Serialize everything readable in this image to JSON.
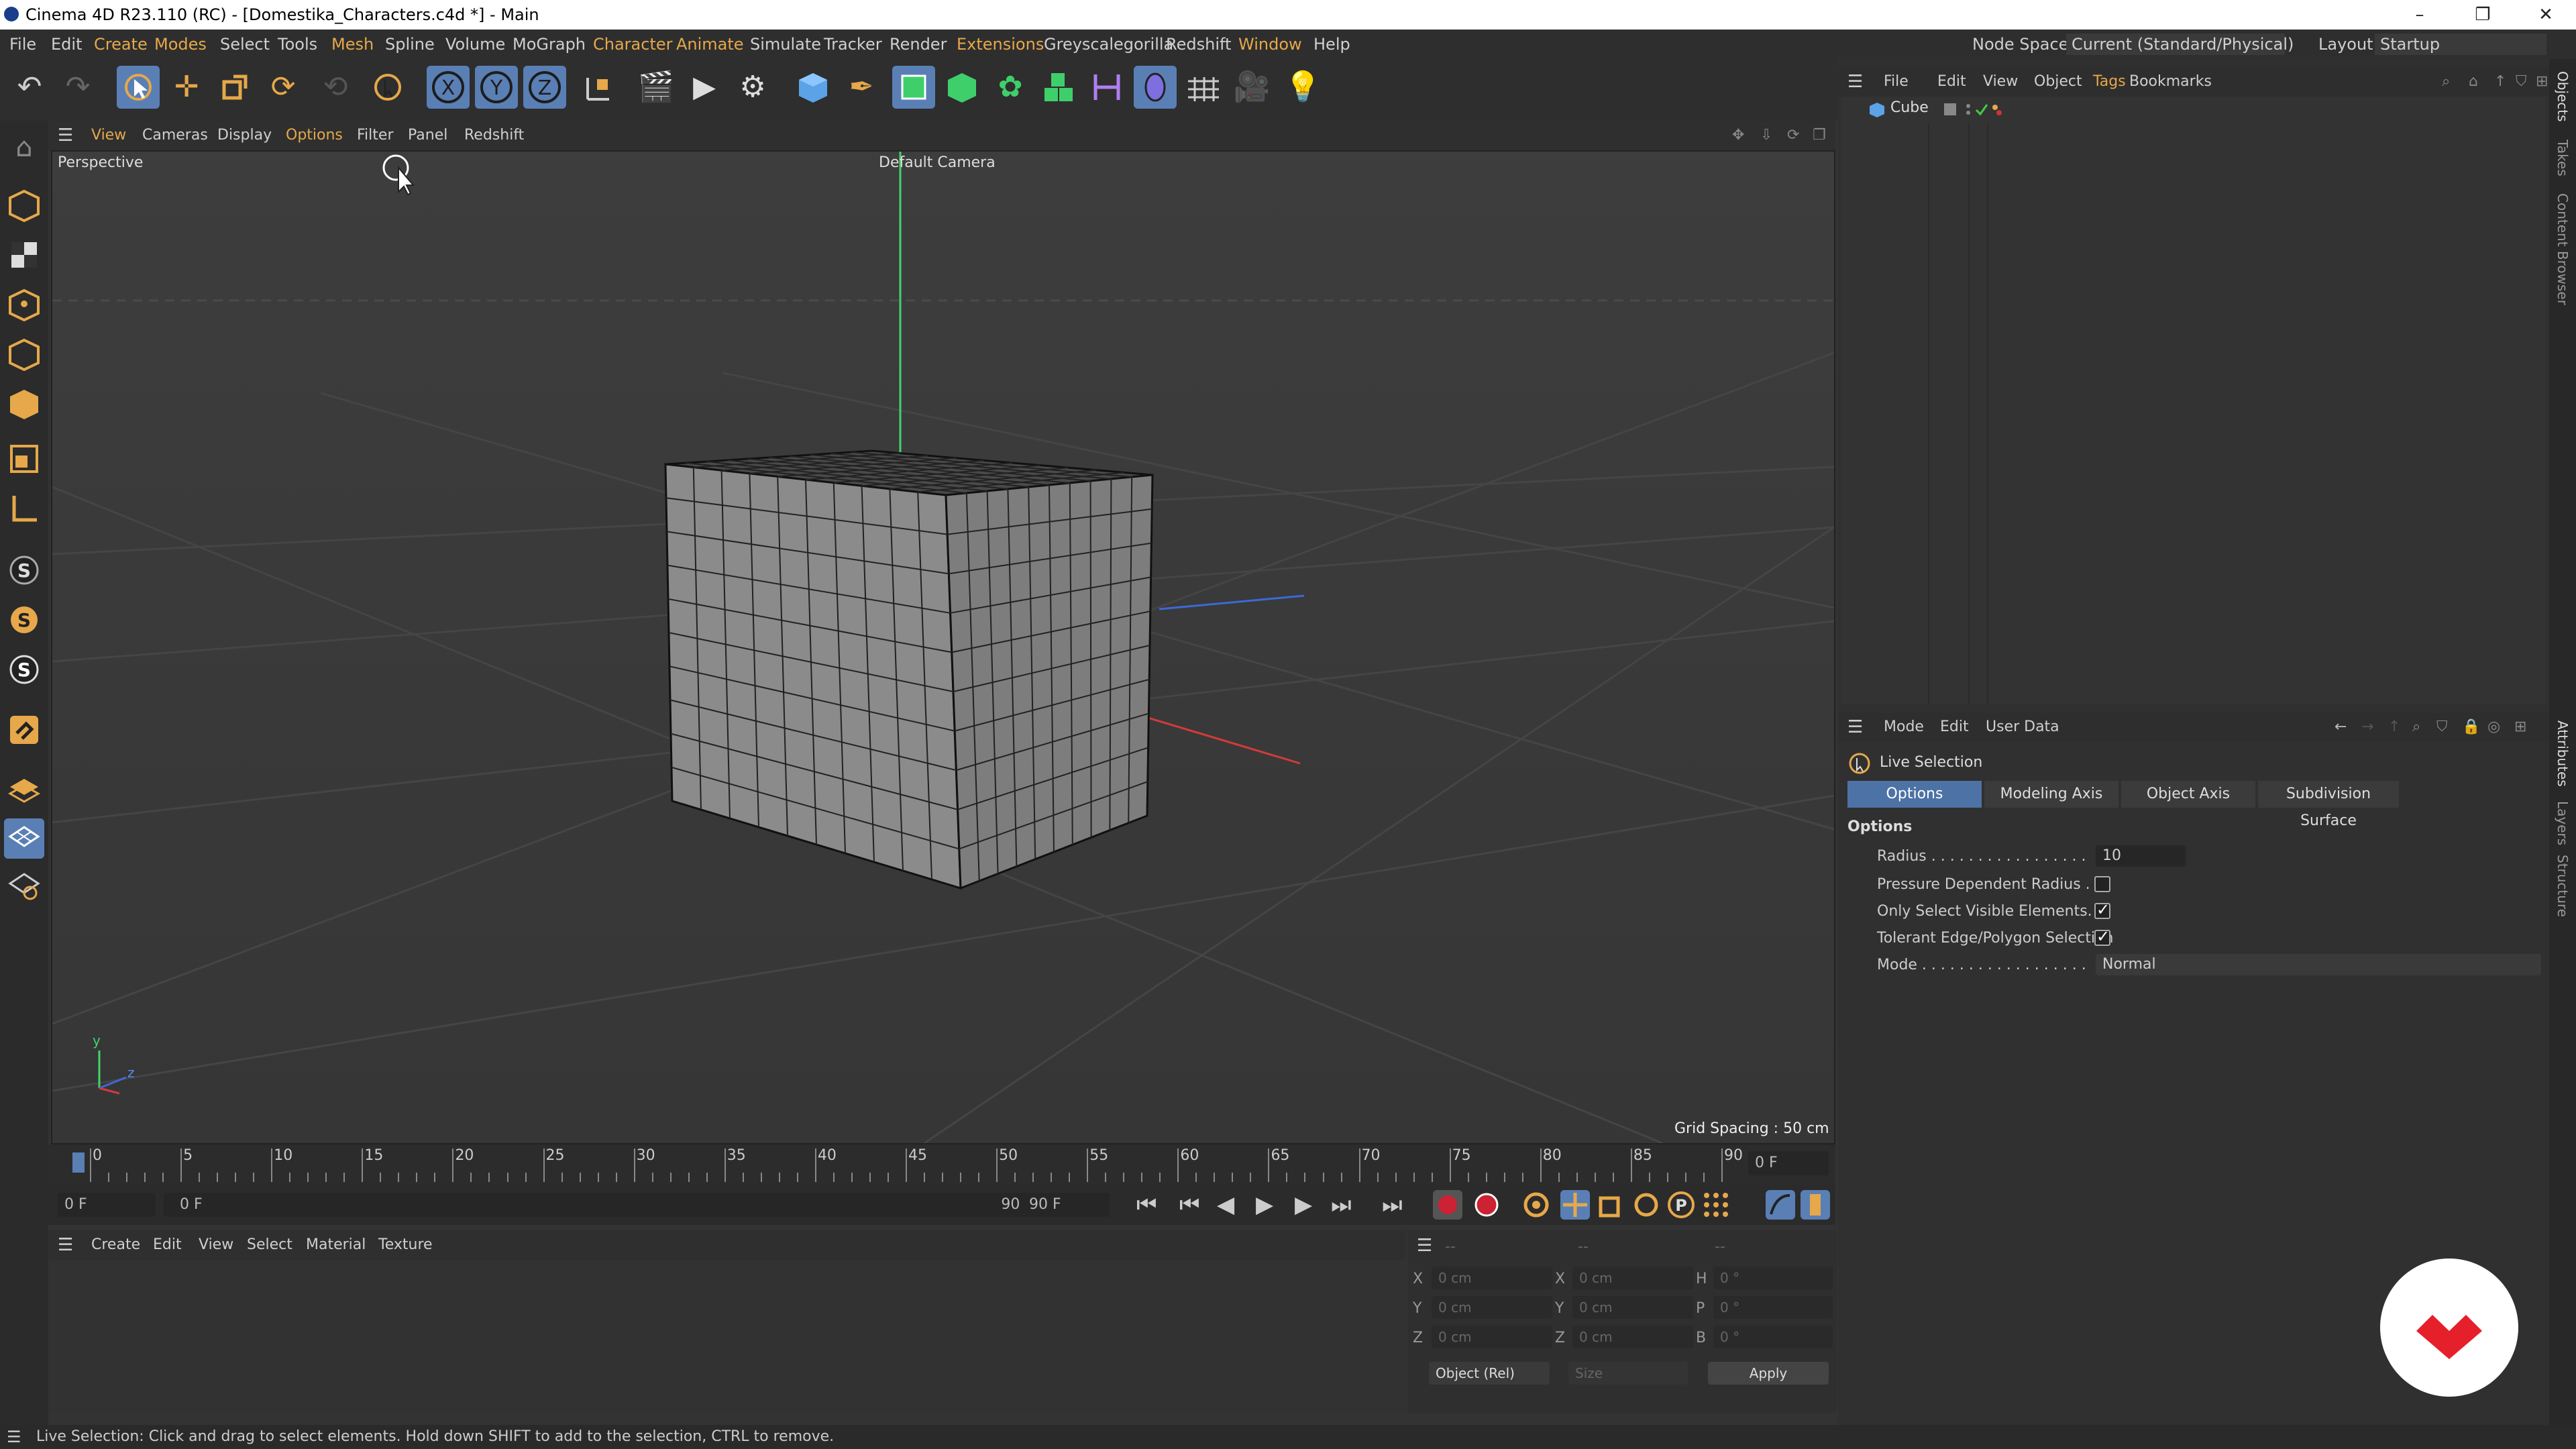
{
  "window": {
    "title": "Cinema 4D R23.110 (RC) - [Domestika_Characters.c4d *] - Main",
    "min": "–",
    "restore": "❐",
    "close": "✕"
  },
  "menu": {
    "items": [
      "File",
      "Edit",
      "Create",
      "Modes",
      "Select",
      "Tools",
      "Mesh",
      "Spline",
      "Volume",
      "MoGraph",
      "Character",
      "Animate",
      "Simulate",
      "Tracker",
      "Render",
      "Extensions",
      "Greyscalegorilla",
      "Redshift",
      "Window",
      "Help"
    ],
    "node_space_label": "Node Space:",
    "node_space_value": "Current (Standard/Physical)",
    "layout_label": "Layout:",
    "layout_value": "Startup"
  },
  "toolbar": {
    "axis_x": "X",
    "axis_y": "Y",
    "axis_z": "Z"
  },
  "viewport": {
    "menu": [
      "View",
      "Cameras",
      "Display",
      "Options",
      "Filter",
      "Panel",
      "Redshift"
    ],
    "name": "Perspective",
    "camera": "Default Camera",
    "grid_spacing": "Grid Spacing : 50 cm",
    "axis_y": "y",
    "axis_z": "z"
  },
  "timeline": {
    "ticks": [
      "0",
      "5",
      "10",
      "15",
      "20",
      "25",
      "30",
      "35",
      "40",
      "45",
      "50",
      "55",
      "60",
      "65",
      "70",
      "75",
      "80",
      "85",
      "90"
    ],
    "current": "0 F",
    "start_field": "0 F",
    "range_start": "0 F",
    "range_end": "90 F",
    "end_field": "90 F"
  },
  "material": {
    "menu": [
      "Create",
      "Edit",
      "View",
      "Select",
      "Material",
      "Texture"
    ]
  },
  "coords": {
    "rows": [
      {
        "a": "X",
        "av": "0 cm",
        "b": "X",
        "bv": "0 cm",
        "c": "H",
        "cv": "0 °"
      },
      {
        "a": "Y",
        "av": "0 cm",
        "b": "Y",
        "bv": "0 cm",
        "c": "P",
        "cv": "0 °"
      },
      {
        "a": "Z",
        "av": "0 cm",
        "b": "Z",
        "bv": "0 cm",
        "c": "B",
        "cv": "0 °"
      }
    ],
    "mode": "Object (Rel)",
    "size": "Size",
    "apply": "Apply",
    "dash1": "--",
    "dash2": "--",
    "dash3": "--"
  },
  "objects": {
    "menu": [
      "File",
      "Edit",
      "View",
      "Object",
      "Tags",
      "Bookmarks"
    ],
    "cube": "Cube"
  },
  "attributes": {
    "menu": [
      "Mode",
      "Edit",
      "User Data"
    ],
    "tool": "Live Selection",
    "tabs": [
      "Options",
      "Modeling Axis",
      "Object Axis",
      "Subdivision Surface"
    ],
    "section": "Options",
    "radius_label": "Radius . . . . . . . . . . . . . . . . .",
    "radius_value": "10",
    "pressure_label": "Pressure Dependent Radius . . .",
    "visible_label": "Only Select Visible Elements. . .",
    "tolerant_label": "Tolerant Edge/Polygon Selection",
    "mode_label": "Mode . . . . . . . . . . . . . . . . . .",
    "mode_value": "Normal"
  },
  "sidetabs": [
    "Objects",
    "Takes",
    "Content Browser",
    "Attributes",
    "Layers",
    "Structure"
  ],
  "status": "Live Selection: Click and drag to select elements. Hold down SHIFT to add to the selection, CTRL to remove.",
  "colors": {
    "accent": "#e6a84a",
    "active_tool": "#5a7fb5",
    "tab_on": "#4d72a6",
    "logo": "#e5202b"
  }
}
